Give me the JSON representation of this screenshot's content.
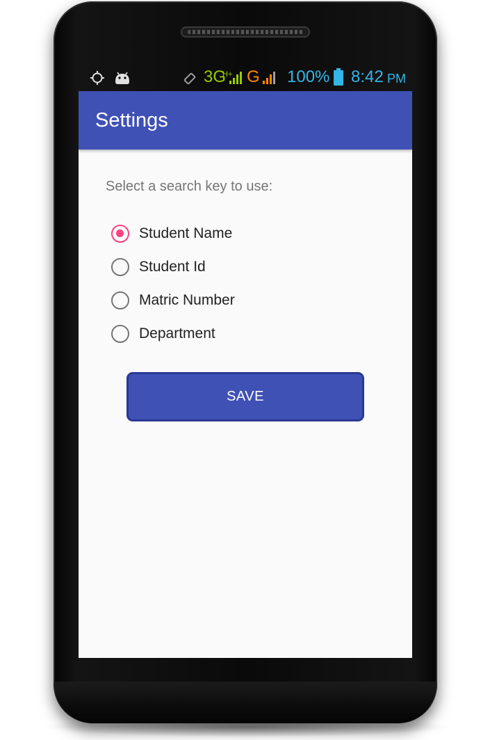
{
  "status_bar": {
    "network_3g": "3G",
    "network_hplus": "H+",
    "network_g": "G",
    "battery_percent": "100%",
    "time": "8:42",
    "ampm": "PM",
    "icons": [
      "gps-icon",
      "android-debug-icon",
      "rotate-icon",
      "signal-icon-3g",
      "signal-icon-g",
      "battery-icon"
    ],
    "colors": {
      "accent": "#33b5e5",
      "green": "#99cc00",
      "orange": "#ff8800"
    }
  },
  "app_bar": {
    "title": "Settings",
    "color": "#3f51b5"
  },
  "settings": {
    "prompt": "Select a search key to use:",
    "options": [
      {
        "label": "Student Name",
        "checked": true
      },
      {
        "label": "Student Id",
        "checked": false
      },
      {
        "label": "Matric Number",
        "checked": false
      },
      {
        "label": "Department",
        "checked": false
      }
    ],
    "save_label": "SAVE",
    "accent_color": "#ff4081"
  }
}
